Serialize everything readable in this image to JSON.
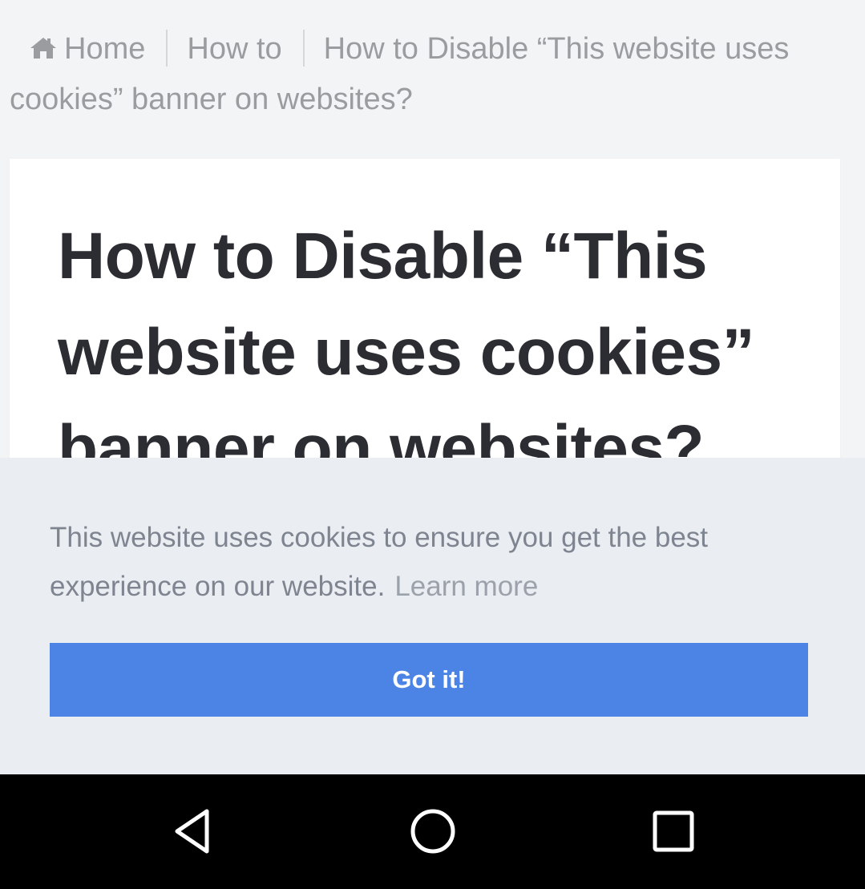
{
  "breadcrumb": {
    "home_label": "Home",
    "category_label": "How to",
    "current_label": "How to Disable “This website uses cookies” banner on websites?"
  },
  "article": {
    "title": "How to Disable “This website uses cookies” banner on websites?"
  },
  "cookie_banner": {
    "message": "This website uses cookies to ensure you get the best experience on our website.",
    "learn_more_label": "Learn more",
    "accept_label": "Got it!"
  },
  "colors": {
    "accent_button": "#4c84e6",
    "banner_background": "#eaedf1",
    "title_text": "#2b2d33",
    "breadcrumb_text": "#9a9ca0",
    "navbar_background": "#000000"
  },
  "navigation_bar": {
    "buttons": [
      "back-icon",
      "home-circle-icon",
      "recent-apps-icon"
    ]
  }
}
